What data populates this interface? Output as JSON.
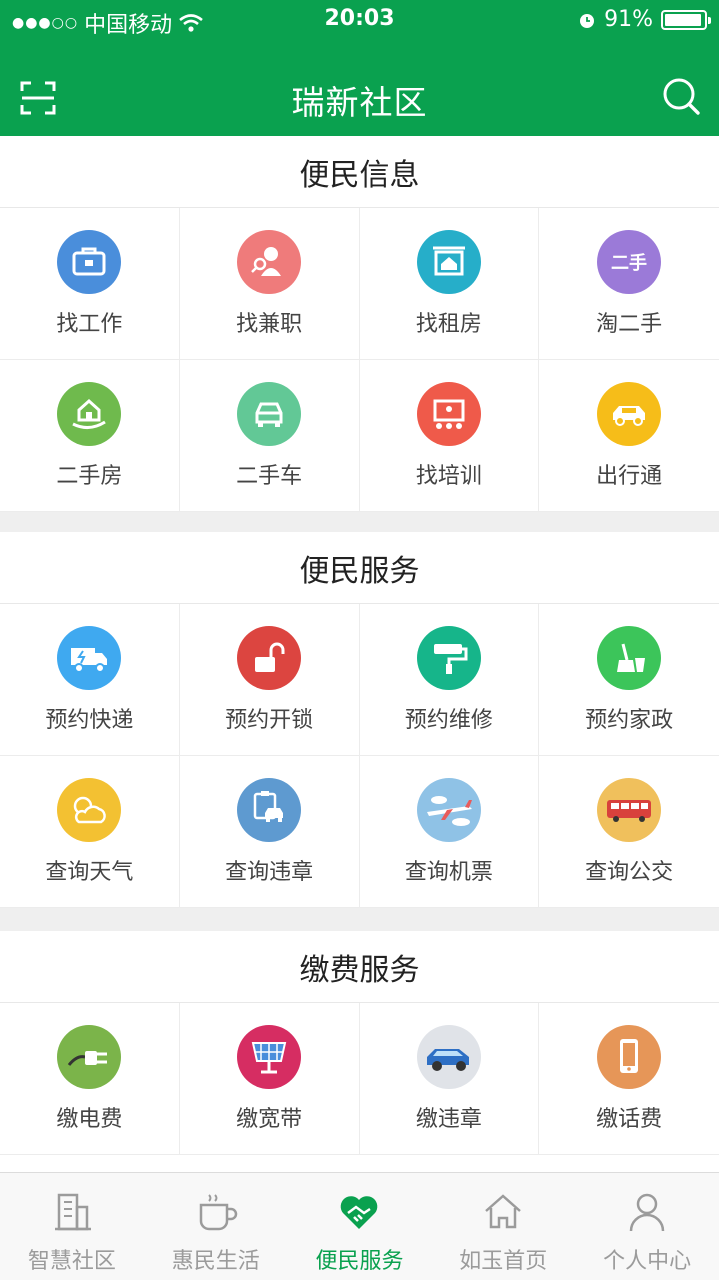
{
  "status": {
    "carrier": "中国移动",
    "time": "20:03",
    "battery": "91%"
  },
  "header": {
    "title": "瑞新社区"
  },
  "sections": [
    {
      "title": "便民信息",
      "items": [
        "找工作",
        "找兼职",
        "找租房",
        "淘二手",
        "二手房",
        "二手车",
        "找培训",
        "出行通"
      ]
    },
    {
      "title": "便民服务",
      "items": [
        "预约快递",
        "预约开锁",
        "预约维修",
        "预约家政",
        "查询天气",
        "查询违章",
        "查询机票",
        "查询公交"
      ]
    },
    {
      "title": "缴费服务",
      "items": [
        "缴电费",
        "缴宽带",
        "缴违章",
        "缴话费"
      ]
    }
  ],
  "icons": {
    "taoershou_glyph": "二手"
  },
  "tabs": [
    {
      "label": "智慧社区"
    },
    {
      "label": "惠民生活"
    },
    {
      "label": "便民服务",
      "active": true
    },
    {
      "label": "如玉首页"
    },
    {
      "label": "个人中心"
    }
  ],
  "colors": {
    "brand": "#0aa14f",
    "tab_inactive": "#9b9b9b"
  }
}
